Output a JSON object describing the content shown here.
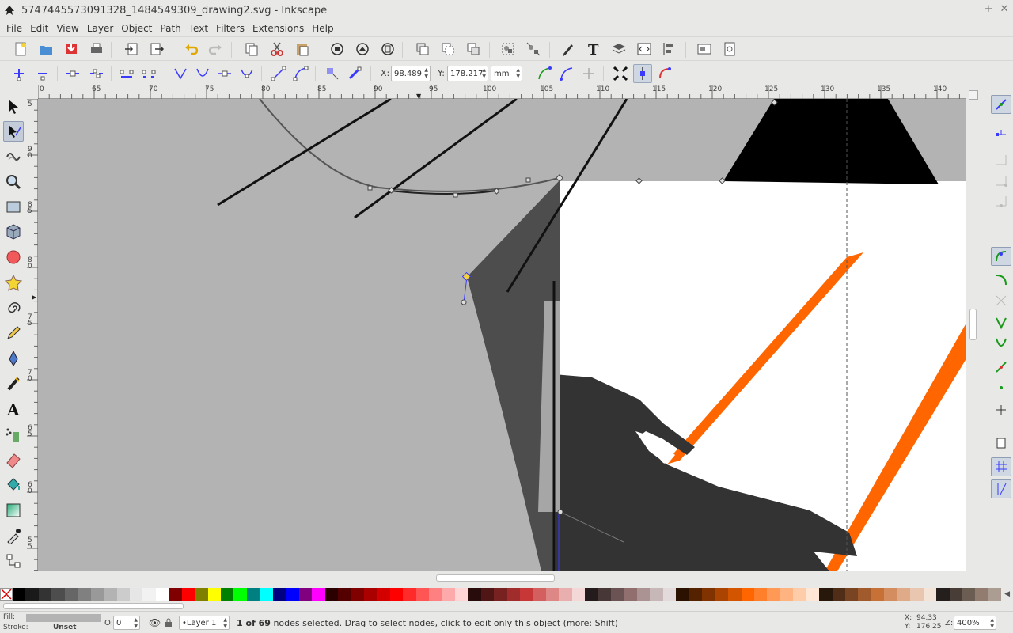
{
  "window": {
    "title": "5747445573091328_1484549309_drawing2.svg - Inkscape"
  },
  "menu": [
    "File",
    "Edit",
    "View",
    "Layer",
    "Object",
    "Path",
    "Text",
    "Filters",
    "Extensions",
    "Help"
  ],
  "node_controls": {
    "x_label": "X:",
    "x_value": "98.489",
    "y_label": "Y:",
    "y_value": "178.217",
    "unit": "mm"
  },
  "ruler": {
    "top": [
      "0",
      "65",
      "70",
      "75",
      "80",
      "85",
      "90",
      "95",
      "100",
      "105",
      "110",
      "115",
      "120",
      "125",
      "130",
      "135",
      "140"
    ],
    "left": [
      "5",
      "9 0",
      "8 5",
      "8 0",
      "7 5",
      "7 0",
      "6 5",
      "6 0",
      "5 5"
    ]
  },
  "status": {
    "fill_label": "Fill:",
    "stroke_label": "Stroke:",
    "stroke_value": "Unset",
    "opacity_label": "O:",
    "opacity_value": "0",
    "layer": "•Layer 1",
    "message_bold": "1 of 69",
    "message": " nodes selected. Drag to select nodes, click to edit only this object (more: Shift)",
    "cursor_x_label": "X:",
    "cursor_x": "94.33",
    "cursor_y_label": "Y:",
    "cursor_y": "176.25",
    "zoom_label": "Z:",
    "zoom": "400%"
  },
  "colors": {
    "canvas_gray": "#b3b3b3",
    "dark_gray": "#4d4d4d",
    "hand": "#333333",
    "orange": "#ff6600",
    "selection_blue": "#3a3aff"
  },
  "palette": [
    "#000000",
    "#1a1a1a",
    "#333333",
    "#4d4d4d",
    "#666666",
    "#808080",
    "#999999",
    "#b3b3b3",
    "#cccccc",
    "#e6e6e6",
    "#f2f2f2",
    "#ffffff",
    "#800000",
    "#ff0000",
    "#808000",
    "#ffff00",
    "#008000",
    "#00ff00",
    "#008080",
    "#00ffff",
    "#000080",
    "#0000ff",
    "#800080",
    "#ff00ff",
    "#2b0000",
    "#550000",
    "#800000",
    "#aa0000",
    "#d40000",
    "#ff0000",
    "#ff2a2a",
    "#ff5555",
    "#ff8080",
    "#ffaaaa",
    "#ffd5d5",
    "#280b0b",
    "#501616",
    "#782121",
    "#a02c2c",
    "#c83737",
    "#d35f5f",
    "#de8787",
    "#e9afaf",
    "#f4d7d7",
    "#241c1c",
    "#483737",
    "#6c5353",
    "#916f6f",
    "#ac9393",
    "#c8b7b7",
    "#e3dbdb",
    "#2b1100",
    "#552200",
    "#803300",
    "#aa4400",
    "#d45500",
    "#ff6600",
    "#ff7f2a",
    "#ff9955",
    "#ffb380",
    "#ffccaa",
    "#ffe6d5",
    "#28170b",
    "#502d16",
    "#784421",
    "#a05a2c",
    "#c87137",
    "#d38d5f",
    "#deaa87",
    "#e9c6af",
    "#f4e3d7",
    "#241f1c",
    "#483e37",
    "#6c5d53",
    "#917c6f",
    "#ac9d93"
  ]
}
